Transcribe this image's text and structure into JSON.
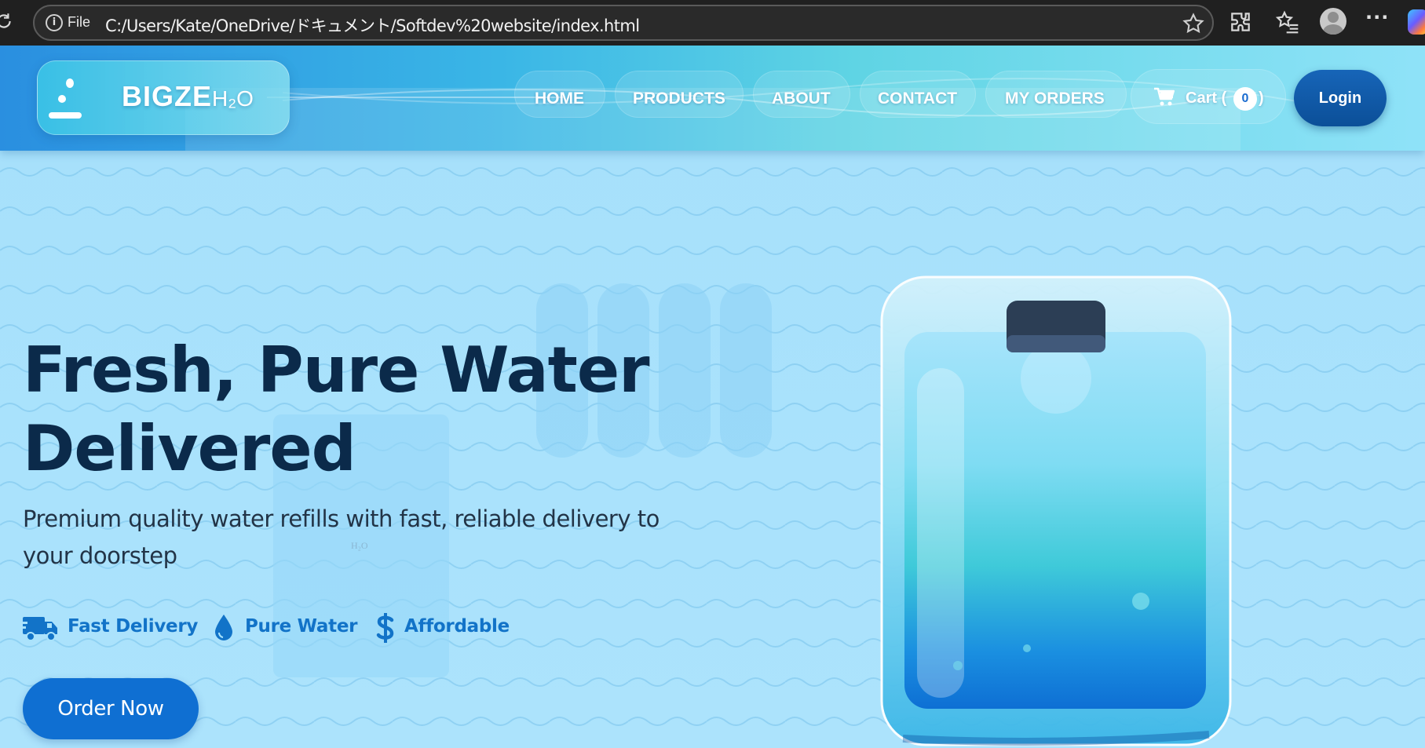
{
  "browser": {
    "file_label": "File",
    "url": "C:/Users/Kate/OneDrive/ドキュメント/Softdev%20website/index.html"
  },
  "header": {
    "logo_text": "BIGZE",
    "logo_suffix": "H₂O",
    "nav": [
      "HOME",
      "PRODUCTS",
      "ABOUT",
      "CONTACT",
      "MY ORDERS"
    ],
    "cart_label": "Cart (",
    "cart_count": "0",
    "cart_close": ")",
    "login": "Login"
  },
  "hero": {
    "title": "Fresh, Pure Water Delivered",
    "subtitle": "Premium quality water refills with fast, reliable delivery to your doorstep",
    "features": [
      {
        "icon": "truck-icon",
        "label": "Fast Delivery"
      },
      {
        "icon": "water-drop-icon",
        "label": "Pure Water"
      },
      {
        "icon": "dollar-icon",
        "label": "Affordable"
      }
    ],
    "cta": "Order Now",
    "decor_text": "H₂O"
  },
  "colors": {
    "accent": "#0f6fd2",
    "heading": "#0b2a4a",
    "feature": "#1273c8",
    "login": "#0b4f98"
  }
}
